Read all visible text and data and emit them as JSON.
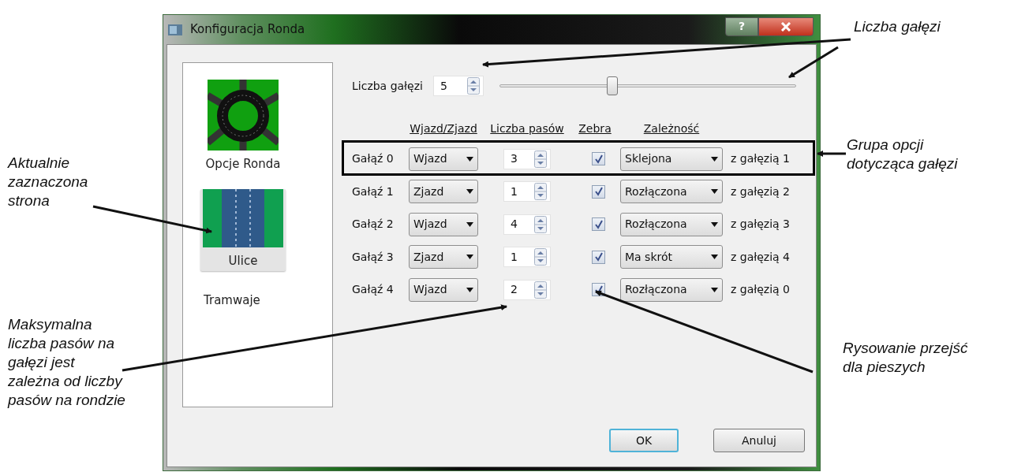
{
  "window": {
    "title": "Konfiguracja Ronda",
    "help": "?"
  },
  "pages": [
    {
      "label": "Opcje Ronda",
      "kind": "roundabout",
      "selected": false
    },
    {
      "label": "Ulice",
      "kind": "street",
      "selected": true
    },
    {
      "label": "Tramwaje",
      "kind": "text",
      "selected": false
    }
  ],
  "branch_count": {
    "label": "Liczba gałęzi",
    "value": "5",
    "level": 0.38
  },
  "columns": [
    "Wjazd/Zjazd",
    "Liczba pasów",
    "Zebra",
    "Zależność"
  ],
  "branches": [
    {
      "label": "Gałąź 0",
      "direction": "Wjazd",
      "lanes": "3",
      "zebra": true,
      "dependency": "Sklejona",
      "target": "z gałęzią 1"
    },
    {
      "label": "Gałąź 1",
      "direction": "Zjazd",
      "lanes": "1",
      "zebra": true,
      "dependency": "Rozłączona",
      "target": "z gałęzią 2"
    },
    {
      "label": "Gałąź 2",
      "direction": "Wjazd",
      "lanes": "4",
      "zebra": true,
      "dependency": "Rozłączona",
      "target": "z gałęzią 3"
    },
    {
      "label": "Gałąź 3",
      "direction": "Zjazd",
      "lanes": "1",
      "zebra": true,
      "dependency": "Ma skrót",
      "target": "z gałęzią 4"
    },
    {
      "label": "Gałąź 4",
      "direction": "Wjazd",
      "lanes": "2",
      "zebra": true,
      "dependency": "Rozłączona",
      "target": "z gałęzią 0"
    }
  ],
  "buttons": [
    {
      "label": "OK",
      "default": true
    },
    {
      "label": "Anuluj",
      "default": false
    }
  ],
  "annotations": [
    "Liczba gałęzi",
    "Grupa opcji\ndotycząca gałęzi",
    "Aktualnie\nzaznaczona\nstrona",
    "Maksymalna\nliczba pasów na\ngałęzi jest\nzależna od liczby\npasów na rondzie",
    "Rysowanie przejść\ndla pieszych"
  ]
}
